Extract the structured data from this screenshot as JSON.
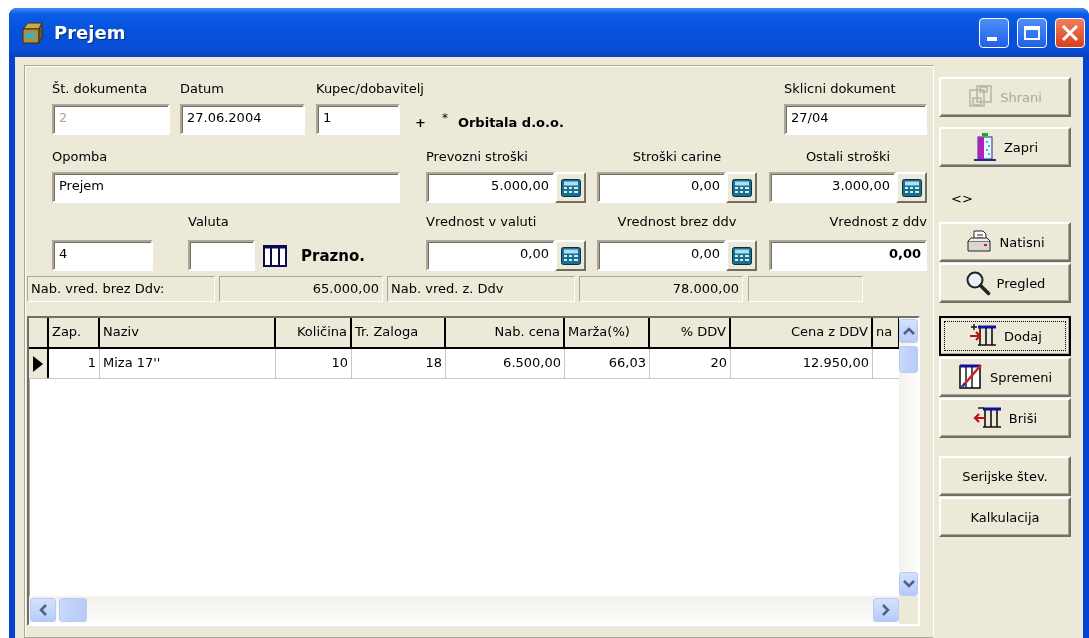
{
  "window": {
    "title": "Prejem"
  },
  "form": {
    "document_number": {
      "label": "Št. dokumenta",
      "value": "2",
      "disabled": true
    },
    "date": {
      "label": "Datum",
      "value": "27.06.2004",
      "disabled": false
    },
    "customer": {
      "label": "Kupec/dobavitelj",
      "value": "1",
      "add_sign": "+",
      "marker": "*",
      "name": "Orbitala d.o.o."
    },
    "reference_document": {
      "label": "Sklicni dokument",
      "value": "27/04"
    },
    "note": {
      "label": "Opomba",
      "value": "Prejem"
    },
    "costs": [
      {
        "label": "Prevozni stroški",
        "value": "5.000,00",
        "kind": "calc"
      },
      {
        "label": "Stroški carine",
        "value": "0,00",
        "kind": "calc"
      },
      {
        "label": "Ostali stroški",
        "value": "3.000,00",
        "kind": "calc"
      }
    ],
    "field_4": {
      "value": "4"
    },
    "currency": {
      "label": "Valuta",
      "status": "Prazno."
    },
    "values": [
      {
        "label": "Vrednost v valuti",
        "value": "0,00",
        "kind": "calc"
      },
      {
        "label": "Vrednost brez ddv",
        "value": "0,00",
        "kind": "calc"
      },
      {
        "label": "Vrednost z ddv",
        "value": "0,00",
        "kind": "total"
      }
    ]
  },
  "summary": [
    {
      "label": "Nab. vred. brez Ddv:",
      "value": "65.000,00"
    },
    {
      "label": "Nab. vred. z. Ddv",
      "value": "78.000,00"
    }
  ],
  "table": {
    "columns": [
      "Zap.",
      "Naziv",
      "Količina",
      "Tr. Zaloga",
      "Nab. cena",
      "Marža(%)",
      "% DDV",
      "Cena z DDV",
      "na"
    ],
    "rows": [
      {
        "selected": true,
        "cells": [
          "1",
          "Miza 17''",
          "10",
          "18",
          "6.500,00",
          "66,03",
          "20",
          "12.950,00"
        ]
      }
    ]
  },
  "side_panel": [
    {
      "kind": "group",
      "buttons": [
        {
          "label": "Shrani",
          "kind": "save",
          "disabled": true,
          "focused": false
        },
        {
          "label": "Zapri",
          "kind": "exit",
          "disabled": false,
          "focused": false
        }
      ]
    },
    {
      "kind": "symbol",
      "text": "<>"
    },
    {
      "kind": "group",
      "buttons": [
        {
          "label": "Natisni",
          "kind": "print",
          "disabled": false,
          "focused": false
        },
        {
          "label": "Pregled",
          "kind": "search",
          "disabled": false,
          "focused": false
        }
      ]
    },
    {
      "kind": "group",
      "buttons": [
        {
          "label": "Dodaj",
          "kind": "add",
          "disabled": false,
          "focused": true
        },
        {
          "label": "Spremeni",
          "kind": "edit",
          "disabled": false,
          "focused": false
        },
        {
          "label": "Briši",
          "kind": "delete",
          "disabled": false,
          "focused": false
        }
      ]
    },
    {
      "kind": "group",
      "buttons": [
        {
          "label": "Serijske štev.",
          "kind": "text",
          "disabled": false,
          "focused": false
        },
        {
          "label": "Kalkulacija",
          "kind": "text",
          "disabled": false,
          "focused": false
        }
      ]
    }
  ]
}
